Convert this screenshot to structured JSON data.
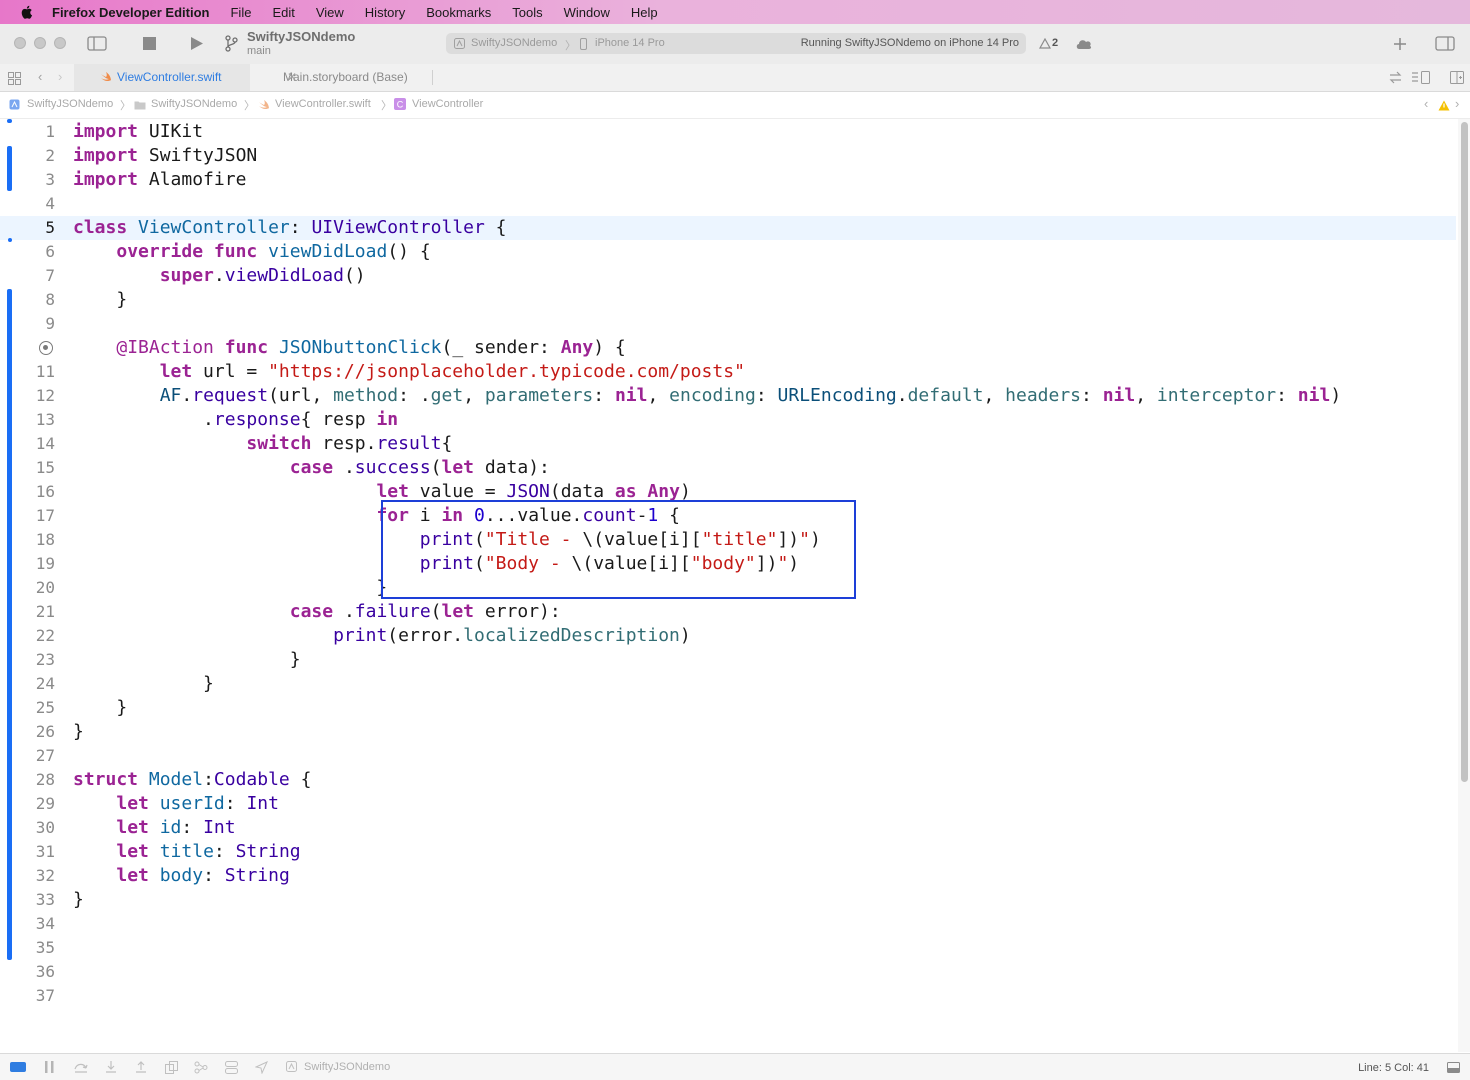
{
  "menubar": {
    "app_name": "Firefox Developer Edition",
    "items": [
      "File",
      "Edit",
      "View",
      "History",
      "Bookmarks",
      "Tools",
      "Window",
      "Help"
    ]
  },
  "toolbar": {
    "scheme_title": "SwiftyJSONdemo",
    "branch": "main",
    "activity": {
      "scheme": "SwiftyJSONdemo",
      "device": "iPhone 14 Pro",
      "status": "Running SwiftyJSONdemo on iPhone 14 Pro"
    },
    "warning_count": "2"
  },
  "tabs": {
    "active": "ViewController.swift",
    "inactive": "Main.storyboard (Base)"
  },
  "jumpbar": {
    "items": [
      "SwiftyJSONdemo",
      "SwiftyJSONdemo",
      "ViewController.swift",
      "ViewController"
    ]
  },
  "editor": {
    "current_line": 5,
    "line_numbers": [
      "1",
      "2",
      "3",
      "4",
      "5",
      "6",
      "7",
      "8",
      "9",
      "",
      "11",
      "12",
      "13",
      "14",
      "15",
      "16",
      "17",
      "18",
      "19",
      "20",
      "21",
      "22",
      "23",
      "24",
      "25",
      "26",
      "27",
      "28",
      "29",
      "30",
      "31",
      "32",
      "33",
      "34",
      "35",
      "36",
      "37"
    ]
  },
  "statusbar": {
    "scheme": "SwiftyJSONdemo",
    "cursor": "Line: 5  Col: 41"
  },
  "colors": {
    "keyword": "#9b2393",
    "type": "#3900a0",
    "string": "#c41a16",
    "number": "#1c00cf",
    "change_bar": "#1a6ef5",
    "highlight_box": "#1d3fd8"
  }
}
